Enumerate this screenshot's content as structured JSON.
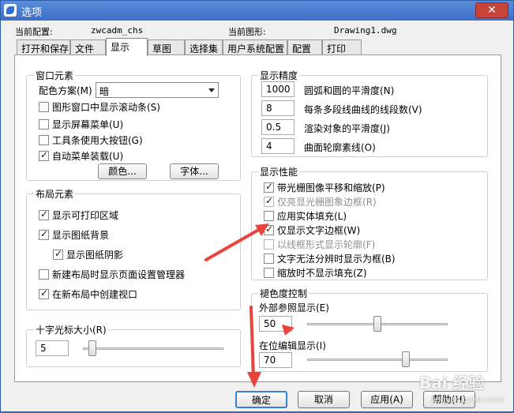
{
  "window": {
    "title": "选项",
    "close_label": "✕"
  },
  "info": {
    "config_label": "当前配置:",
    "config_value": "zwcadm_chs",
    "drawing_label": "当前图形:",
    "drawing_value": "Drawing1.dwg"
  },
  "tabs": [
    {
      "label": "打开和保存"
    },
    {
      "label": "文件"
    },
    {
      "label": "显示"
    },
    {
      "label": "草图"
    },
    {
      "label": "选择集"
    },
    {
      "label": "用户系统配置"
    },
    {
      "label": "配置"
    },
    {
      "label": "打印"
    }
  ],
  "active_tab": "显示",
  "window_elements": {
    "title": "窗口元素",
    "color_scheme_label": "配色方案(M)",
    "color_scheme_value": "暗",
    "scrollbars": {
      "label": "图形窗口中显示滚动条(S)",
      "checked": false
    },
    "screen_menu": {
      "label": "显示屏幕菜单(U)",
      "checked": false
    },
    "large_buttons": {
      "label": "工具条使用大按钮(G)",
      "checked": false
    },
    "auto_menu": {
      "label": "自动菜单装载(U)",
      "checked": true
    },
    "colors_button": "颜色...",
    "fonts_button": "字体..."
  },
  "layout_elements": {
    "title": "布局元素",
    "print_area": {
      "label": "显示可打印区域",
      "checked": true
    },
    "paper_bg": {
      "label": "显示图纸背景",
      "checked": true
    },
    "paper_shadow": {
      "label": "显示图纸阴影",
      "checked": true
    },
    "page_setup": {
      "label": "新建布局时显示页面设置管理器",
      "checked": false
    },
    "create_viewport": {
      "label": "在新布局中创建视口",
      "checked": true
    }
  },
  "crosshair": {
    "title": "十字光标大小(R)",
    "value": "5"
  },
  "display_resolution": {
    "title": "显示精度",
    "arc_smoothness": {
      "value": "1000",
      "label": "圆弧和圆的平滑度(N)"
    },
    "polyline_segments": {
      "value": "8",
      "label": "每条多段线曲线的线段数(V)"
    },
    "render_smoothness": {
      "value": "0.5",
      "label": "渲染对象的平滑度(J)"
    },
    "contour_lines": {
      "value": "4",
      "label": "曲面轮廓素线(O)"
    }
  },
  "display_performance": {
    "title": "显示性能",
    "raster_pan": {
      "label": "带光栅图像平移和缩放(P)",
      "checked": true,
      "disabled": false
    },
    "raster_highlight": {
      "label": "仅亮显光栅图象边框(R)",
      "checked": true,
      "disabled": true
    },
    "solid_fill": {
      "label": "应用实体填充(L)",
      "checked": false,
      "disabled": false
    },
    "text_frame": {
      "label": "仅显示文字边框(W)",
      "checked": true,
      "disabled": false
    },
    "wireframe_silhouette": {
      "label": "以线框形式显示轮廓(F)",
      "checked": false,
      "disabled": true
    },
    "text_unresolved": {
      "label": "文字无法分辨时显示为框(B)",
      "checked": false,
      "disabled": false
    },
    "zoom_no_fill": {
      "label": "缩放时不显示填充(Z)",
      "checked": false,
      "disabled": false
    }
  },
  "fade_control": {
    "title": "褪色度控制",
    "xref_label": "外部参照显示(E)",
    "xref_value": "50",
    "xref_level": 0.5,
    "inplace_label": "在位编辑显示(I)",
    "inplace_value": "70",
    "inplace_level": 0.7
  },
  "buttons": {
    "ok": "确定",
    "cancel": "取消",
    "apply": "应用(A)",
    "help": "帮助(H)"
  },
  "watermark": {
    "text": "Bai 经验",
    "sub": "jingyan.baidu.com"
  },
  "colors": {
    "annotation_arrow": "#e9453d",
    "title_bar": "#3c6ec7"
  }
}
